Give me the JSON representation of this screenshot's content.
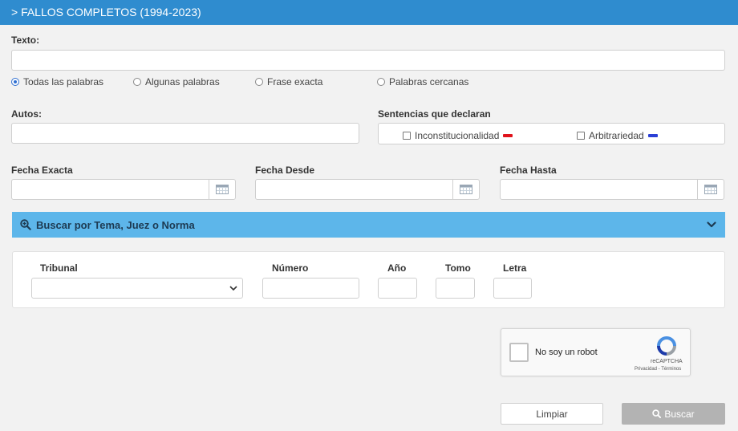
{
  "header": {
    "title": "> FALLOS COMPLETOS (1994-2023)"
  },
  "texto": {
    "label": "Texto:",
    "options": [
      {
        "label": "Todas las palabras",
        "checked": true
      },
      {
        "label": "Algunas palabras",
        "checked": false
      },
      {
        "label": "Frase exacta",
        "checked": false
      },
      {
        "label": "Palabras cercanas",
        "checked": false
      }
    ]
  },
  "autos": {
    "label": "Autos:"
  },
  "sentencias": {
    "label": "Sentencias que declaran",
    "inconstitucionalidad": {
      "label": "Inconstitucionalidad",
      "color": "#e0121b"
    },
    "arbitrariedad": {
      "label": "Arbitrariedad",
      "color": "#2b3fd6"
    }
  },
  "fechas": {
    "exacta": "Fecha Exacta",
    "desde": "Fecha Desde",
    "hasta": "Fecha Hasta"
  },
  "advanced": {
    "label": "Buscar por Tema, Juez o Norma"
  },
  "filters": {
    "tribunal": "Tribunal",
    "numero": "Número",
    "anio": "Año",
    "tomo": "Tomo",
    "letra": "Letra"
  },
  "recaptcha": {
    "label": "No soy un robot",
    "brand": "reCAPTCHA",
    "links": "Privacidad - Términos"
  },
  "buttons": {
    "clear": "Limpiar",
    "search": "Buscar"
  },
  "colors": {
    "header": "#2f8ccf",
    "advanced_bar": "#5db6ea",
    "search_button": "#b3b3b3"
  }
}
